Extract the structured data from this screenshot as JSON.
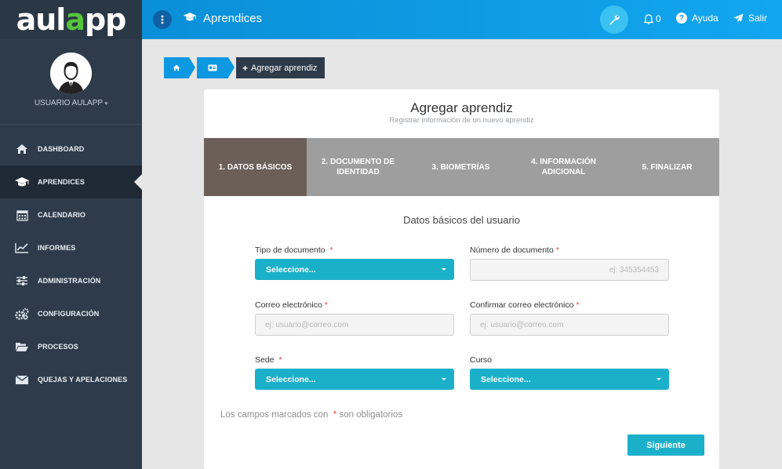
{
  "brand": {
    "logo_text_a": "aul",
    "logo_text_o": "a",
    "logo_text_b": "pp"
  },
  "user": {
    "name": "USUARIO AULAPP",
    "caret": "▾"
  },
  "sidebar": {
    "items": [
      {
        "label": "DASHBOARD",
        "icon": "home-icon"
      },
      {
        "label": "APRENDICES",
        "icon": "graduation-cap-icon",
        "active": true
      },
      {
        "label": "CALENDARIO",
        "icon": "calendar-icon"
      },
      {
        "label": "INFORMES",
        "icon": "line-chart-icon"
      },
      {
        "label": "ADMINISTRACIÓN",
        "icon": "sliders-icon"
      },
      {
        "label": "CONFIGURACIÓN",
        "icon": "gears-icon"
      },
      {
        "label": "PROCESOS",
        "icon": "folder-open-icon"
      },
      {
        "label": "QUEJAS Y APELACIONES",
        "icon": "envelope-icon"
      }
    ]
  },
  "topbar": {
    "title": "Aprendices",
    "notifications_count": "0",
    "help_label": "Ayuda",
    "exit_label": "Salir"
  },
  "breadcrumb": {
    "current": "Agregar aprendiz"
  },
  "card": {
    "title": "Agregar aprendiz",
    "subtitle": "Registrar información de un nuevo aprendiz"
  },
  "steps": [
    {
      "label": "1. DATOS BÁSICOS",
      "active": true
    },
    {
      "label": "2. DOCUMENTO DE IDENTIDAD"
    },
    {
      "label": "3. BIOMETRÍAS"
    },
    {
      "label": "4. INFORMACIÓN ADICIONAL"
    },
    {
      "label": "5. FINALIZAR"
    }
  ],
  "form": {
    "section_title": "Datos básicos del usuario",
    "tipo_documento": {
      "label": "Tipo de documento",
      "value": "Seleccione..."
    },
    "numero_documento": {
      "label": "Número de documento",
      "placeholder": "ej: 345354453"
    },
    "correo": {
      "label": "Correo electrónico",
      "placeholder": "ej: usuario@correo.com"
    },
    "confirmar_correo": {
      "label": "Confirmar correo electrónico",
      "placeholder": "ej: usuario@correo.com"
    },
    "sede": {
      "label": "Sede",
      "value": "Seleccione..."
    },
    "curso": {
      "label": "Curso",
      "value": "Seleccione..."
    },
    "required_mark": "*",
    "note_prefix": "Los campos marcados con",
    "note_suffix": "son obligatorios",
    "next_button": "Siguiente"
  },
  "colors": {
    "accent": "#1bb0c9",
    "topbar": "#0d98e2",
    "sidebar": "#2e3b4a",
    "active_step": "#6b5f58",
    "required": "#e3493c"
  }
}
